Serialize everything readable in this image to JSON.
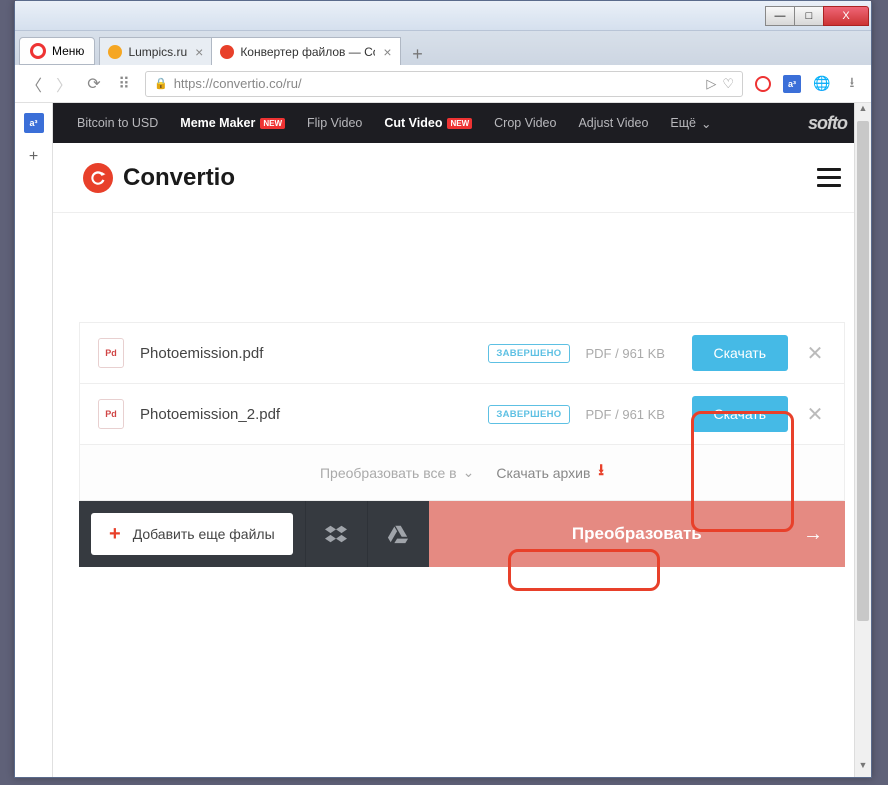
{
  "window": {
    "min": "—",
    "max": "□",
    "close": "X"
  },
  "tabs": {
    "menu": "Меню",
    "t1": {
      "title": "Lumpics.ru"
    },
    "t2": {
      "title": "Конвертер файлов — Co"
    }
  },
  "addr": {
    "url": "https://convertio.co/ru/",
    "send": "▷",
    "heart": "♡"
  },
  "toolbar": {
    "translate": "a³",
    "download": "⭳"
  },
  "sidebar": {
    "translate": "a³",
    "plus": "+"
  },
  "toplinks": {
    "l1": "Bitcoin to USD",
    "l2": "Meme Maker",
    "chip_new": "NEW",
    "l3": "Flip Video",
    "l4": "Cut Video",
    "l5": "Crop Video",
    "l6": "Adjust Video",
    "more": "Ещё",
    "brand": "softo"
  },
  "site": {
    "name": "Convertio"
  },
  "files": [
    {
      "type": "Pd",
      "name": "Photoemission.pdf",
      "status": "ЗАВЕРШЕНО",
      "info": "PDF / 961 KB",
      "dl": "Скачать",
      "x": "✕"
    },
    {
      "type": "Pd",
      "name": "Photoemission_2.pdf",
      "status": "ЗАВЕРШЕНО",
      "info": "PDF / 961 KB",
      "dl": "Скачать",
      "x": "✕"
    }
  ],
  "below": {
    "convert_all": "Преобразовать все в",
    "caret": "⌄",
    "archive": "Скачать архив",
    "dl": "⭳"
  },
  "actions": {
    "add_more": "Добавить еще файлы",
    "plus": "+",
    "dropbox": "⧉",
    "gdrive": "▲",
    "convert": "Преобразовать",
    "arrow": "→"
  },
  "scroll": {
    "up": "▲",
    "down": "▼"
  }
}
